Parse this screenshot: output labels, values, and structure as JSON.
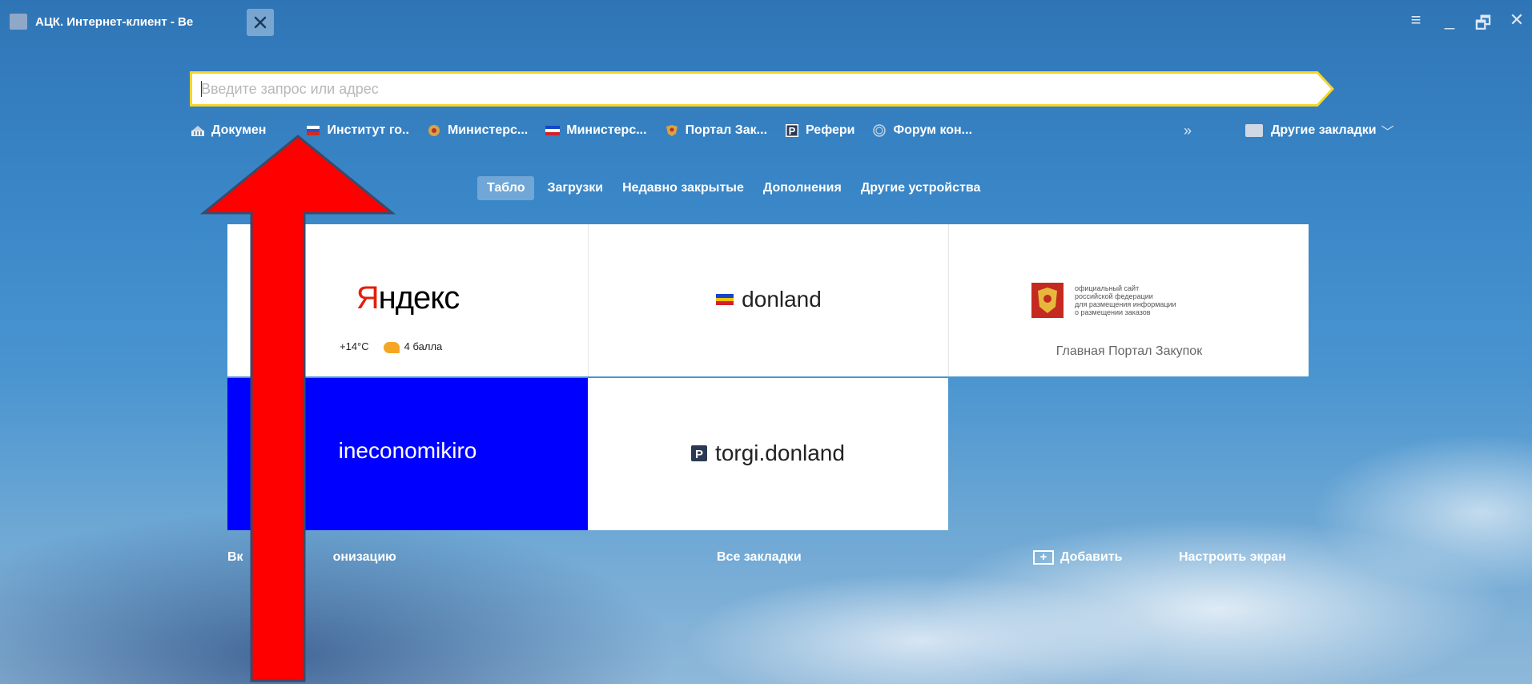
{
  "window": {
    "tab_title": "АЦК. Интернет-клиент - Be",
    "controls": [
      "≡",
      "_",
      "🗗",
      "✕"
    ]
  },
  "omnibox": {
    "placeholder": "Введите запрос или адрес"
  },
  "bookmarks": {
    "items": [
      {
        "label": "Докумен",
        "icon": "document-icon"
      },
      {
        "label": "Институт го..",
        "icon": "flag-icon"
      },
      {
        "label": "Министерс...",
        "icon": "coat-of-arms-icon"
      },
      {
        "label": "Министерс...",
        "icon": "rostov-flag-icon"
      },
      {
        "label": "Портал Зак...",
        "icon": "coat-of-arms-icon"
      },
      {
        "label": "Рефери",
        "icon": "p-icon"
      },
      {
        "label": "Форум кон...",
        "icon": "globe-icon"
      }
    ],
    "more": "»",
    "other": "Другие закладки"
  },
  "nav": {
    "tabs": [
      "Табло",
      "Загрузки",
      "Недавно закрытые",
      "Дополнения",
      "Другие устройства"
    ],
    "active": "Табло"
  },
  "tiles": {
    "yandex": {
      "logo_y": "Я",
      "logo_rest": "ндекс",
      "weather": "+14°C",
      "traffic": "4 балла"
    },
    "donland": {
      "label": "donland"
    },
    "zakupki": {
      "logo_text": "официальный сайт\nроссийской федерации\nдля размещения информации\nо размещении заказов",
      "label": "Главная Портал Закупок"
    },
    "mineco": {
      "label": "ineconomikiro"
    },
    "torgi": {
      "label": "torgi.donland"
    }
  },
  "footer": {
    "sync_left": "Вк",
    "sync_right": "онизацию",
    "all_bookmarks": "Все закладки",
    "add": "Добавить",
    "customize": "Настроить экран"
  },
  "colors": {
    "annotation_arrow": "#ff0000",
    "omnibox_border": "#f5d62a",
    "mineco_tile": "#0000ff"
  }
}
